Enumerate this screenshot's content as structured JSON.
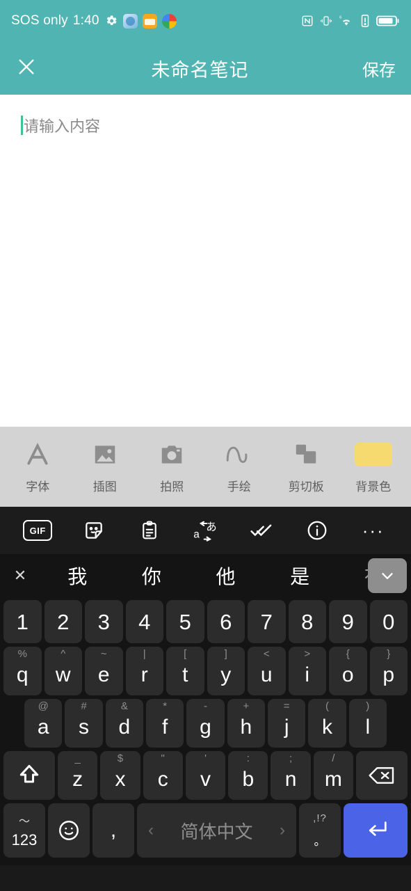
{
  "status_bar": {
    "carrier": "SOS only",
    "time": "1:40",
    "icons_left": [
      "gear-icon",
      "app-icon-blue",
      "app-icon-orange",
      "app-icon-multicolor"
    ],
    "icons_right": [
      "nfc-icon",
      "vibrate-icon",
      "wifi6-icon",
      "alert-icon",
      "battery-icon"
    ],
    "wifi_generation": "6",
    "background_color": "#50b5b2"
  },
  "app_bar": {
    "close_label": "✕",
    "title": "未命名笔记",
    "save_label": "保存",
    "background_color": "#50b5b2"
  },
  "note": {
    "placeholder": "请输入内容",
    "value": "",
    "caret_color": "#3ec28f",
    "background_color": "#ffffff"
  },
  "format_toolbar": {
    "background_color": "#d3d3d3",
    "items": [
      {
        "label": "字体",
        "icon": "font-icon"
      },
      {
        "label": "插图",
        "icon": "image-icon"
      },
      {
        "label": "拍照",
        "icon": "camera-icon"
      },
      {
        "label": "手绘",
        "icon": "handwrite-wave-icon"
      },
      {
        "label": "剪切板",
        "icon": "clipboard-layers-icon"
      },
      {
        "label": "背景色",
        "icon": "background-color-swatch",
        "swatch_color": "#f6da70"
      }
    ]
  },
  "ime_toolbar": {
    "background_color": "#1c1c1c",
    "items": [
      {
        "name": "gif-icon",
        "label": "GIF"
      },
      {
        "name": "sticker-icon",
        "label": ""
      },
      {
        "name": "clipboard-icon",
        "label": ""
      },
      {
        "name": "translate-icon",
        "label": ""
      },
      {
        "name": "spellcheck-icon",
        "label": ""
      },
      {
        "name": "info-icon",
        "label": ""
      },
      {
        "name": "more-icon",
        "label": "···"
      }
    ]
  },
  "candidate_bar": {
    "close_label": "✕",
    "candidates": [
      "我",
      "你",
      "他",
      "是",
      "有"
    ],
    "expand_icon": "chevron-down-icon",
    "expand_bg": "#8e8e8e"
  },
  "keyboard": {
    "background_color": "#141414",
    "key_color": "#2c2c2c",
    "enter_color": "#4a63e7",
    "rows": {
      "numbers": [
        {
          "main": "1"
        },
        {
          "main": "2"
        },
        {
          "main": "3"
        },
        {
          "main": "4"
        },
        {
          "main": "5"
        },
        {
          "main": "6"
        },
        {
          "main": "7"
        },
        {
          "main": "8"
        },
        {
          "main": "9"
        },
        {
          "main": "0"
        }
      ],
      "top": [
        {
          "sup": "%",
          "main": "q"
        },
        {
          "sup": "^",
          "main": "w"
        },
        {
          "sup": "~",
          "main": "e"
        },
        {
          "sup": "|",
          "main": "r"
        },
        {
          "sup": "[",
          "main": "t"
        },
        {
          "sup": "]",
          "main": "y"
        },
        {
          "sup": "<",
          "main": "u"
        },
        {
          "sup": ">",
          "main": "i"
        },
        {
          "sup": "{",
          "main": "o"
        },
        {
          "sup": "}",
          "main": "p"
        }
      ],
      "middle": [
        {
          "sup": "@",
          "main": "a"
        },
        {
          "sup": "#",
          "main": "s"
        },
        {
          "sup": "&",
          "main": "d"
        },
        {
          "sup": "*",
          "main": "f"
        },
        {
          "sup": "-",
          "main": "g"
        },
        {
          "sup": "+",
          "main": "h"
        },
        {
          "sup": "=",
          "main": "j"
        },
        {
          "sup": "(",
          "main": "k"
        },
        {
          "sup": ")",
          "main": "l"
        }
      ],
      "bottom_letters": [
        {
          "sup": "_",
          "main": "z"
        },
        {
          "sup": "$",
          "main": "x"
        },
        {
          "sup": "\"",
          "main": "c"
        },
        {
          "sup": "'",
          "main": "v"
        },
        {
          "sup": ":",
          "main": "b"
        },
        {
          "sup": ";",
          "main": "n"
        },
        {
          "sup": "/",
          "main": "m"
        }
      ]
    },
    "shift_icon": "shift-icon",
    "backspace_icon": "backspace-icon",
    "sym_key": {
      "top": "〜",
      "label": "123"
    },
    "emoji_icon": "emoji-icon",
    "comma_label": ",",
    "space_label": "简体中文",
    "space_prev": "‹",
    "space_next": "›",
    "period_top": ",!?",
    "period_main": "。",
    "enter_icon": "enter-icon"
  }
}
